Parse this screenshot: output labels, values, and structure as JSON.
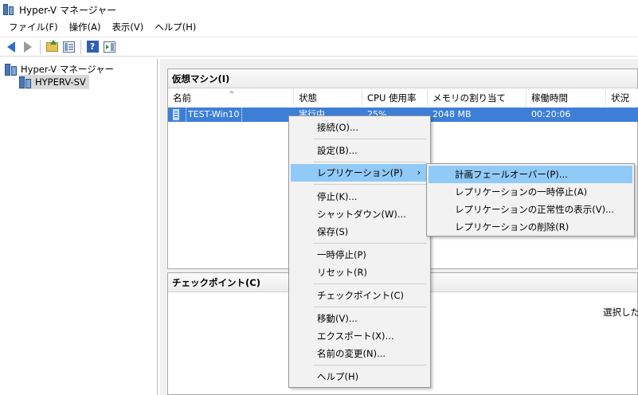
{
  "window": {
    "title": "Hyper-V マネージャー"
  },
  "menubar": {
    "items": [
      "ファイル(F)",
      "操作(A)",
      "表示(V)",
      "ヘルプ(H)"
    ]
  },
  "toolbar": {
    "buttons": [
      "back-arrow-icon",
      "forward-arrow-icon",
      "up-folder-icon",
      "show-hide-tree-icon",
      "help-icon",
      "show-hide-action-pane-icon"
    ]
  },
  "tree": {
    "root": "Hyper-V マネージャー",
    "server": "HYPERV-SV"
  },
  "vm_section": {
    "title": "仮想マシン(I)",
    "columns": [
      "名前",
      "状態",
      "CPU 使用率",
      "メモリの割り当て",
      "稼働時間",
      "状況"
    ],
    "rows": [
      {
        "name": "TEST-Win10",
        "state": "実行中",
        "cpu": "25%",
        "memory": "2048 MB",
        "uptime": "00:20:06",
        "status": ""
      }
    ]
  },
  "checkpoint_section": {
    "title": "チェックポイント(C)",
    "message": "選択した"
  },
  "context_menu": {
    "items": [
      {
        "label": "接続(O)..."
      },
      {
        "label": "設定(B)..."
      },
      {
        "label": "レプリケーション(P)",
        "has_submenu": true,
        "chevron": "›"
      },
      {
        "label": "停止(K)..."
      },
      {
        "label": "シャットダウン(W)..."
      },
      {
        "label": "保存(S)"
      },
      {
        "label": "一時停止(P)"
      },
      {
        "label": "リセット(R)"
      },
      {
        "label": "チェックポイント(C)"
      },
      {
        "label": "移動(V)..."
      },
      {
        "label": "エクスポート(X)..."
      },
      {
        "label": "名前の変更(N)..."
      },
      {
        "label": "ヘルプ(H)"
      }
    ]
  },
  "submenu": {
    "items": [
      {
        "label": "計画フェールオーバー(P)..."
      },
      {
        "label": "レプリケーションの一時停止(A)"
      },
      {
        "label": "レプリケーションの正常性の表示(V)..."
      },
      {
        "label": "レプリケーションの削除(R)"
      }
    ]
  },
  "colors": {
    "selection": "#3d7fd6",
    "menu_highlight": "#91c9f7",
    "menu_background": "#f2f2f2"
  }
}
